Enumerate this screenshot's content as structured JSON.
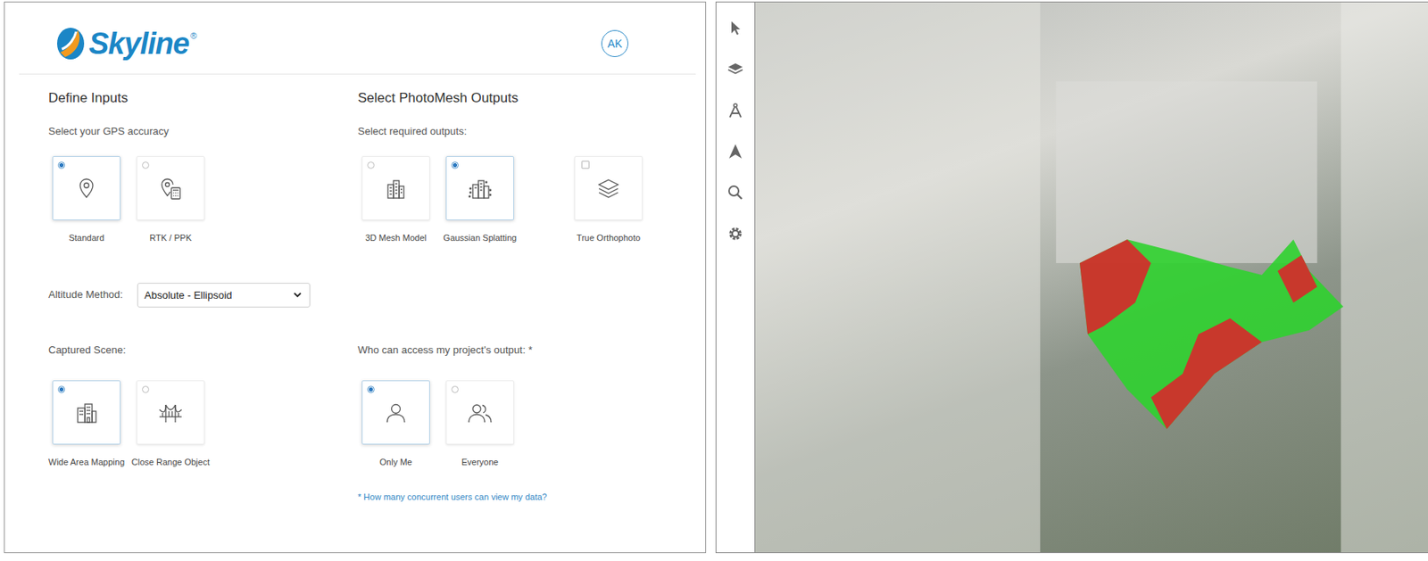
{
  "logo": {
    "text": "Skyline",
    "mark": "®"
  },
  "user": {
    "initials": "AK"
  },
  "inputs": {
    "title": "Define Inputs",
    "gps": {
      "label": "Select your GPS accuracy",
      "options": [
        {
          "label": "Standard",
          "selected": true
        },
        {
          "label": "RTK / PPK",
          "selected": false
        }
      ]
    },
    "altitude": {
      "label": "Altitude Method:",
      "value": "Absolute - Ellipsoid"
    },
    "scene": {
      "label": "Captured Scene:",
      "options": [
        {
          "label": "Wide Area Mapping",
          "selected": true
        },
        {
          "label": "Close Range Object",
          "selected": false
        }
      ]
    }
  },
  "outputs": {
    "title": "Select PhotoMesh Outputs",
    "label": "Select required outputs:",
    "options": [
      {
        "label": "3D Mesh Model",
        "kind": "radio",
        "selected": false
      },
      {
        "label": "Gaussian Splatting",
        "kind": "radio",
        "selected": true
      },
      {
        "label": "True Orthophoto",
        "kind": "checkbox",
        "selected": false
      }
    ],
    "access": {
      "label": "Who can access my project's output: *",
      "options": [
        {
          "label": "Only Me",
          "selected": true
        },
        {
          "label": "Everyone",
          "selected": false
        }
      ],
      "help": "* How many concurrent users can view my data?"
    }
  }
}
